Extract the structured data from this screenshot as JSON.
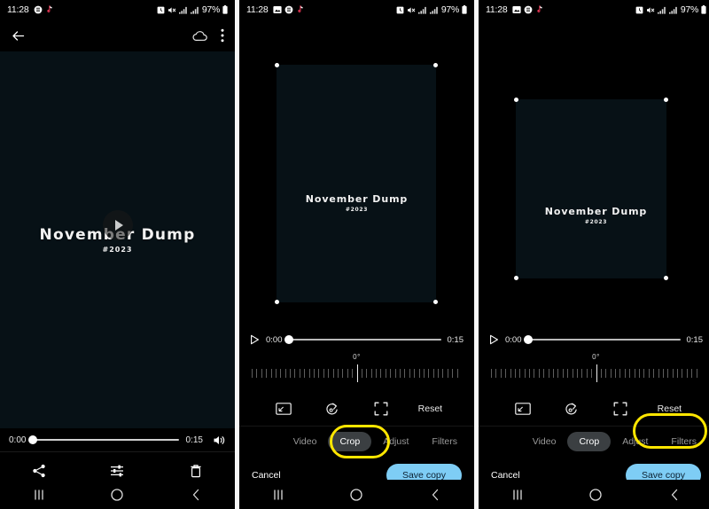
{
  "meta": {
    "app": "Samsung Gallery video editor",
    "panel_count": 3
  },
  "status_bar": {
    "time": "11:28",
    "battery": "97%",
    "left_icons_p1": [
      "browser-icon",
      "tiktok-icon"
    ],
    "left_icons_p2": [
      "image-icon",
      "browser-icon",
      "tiktok-icon"
    ],
    "right_icons": [
      "alarm-icon",
      "mute-icon",
      "signal-icon",
      "signal-icon",
      "battery-icon"
    ]
  },
  "panel1": {
    "appbar": {
      "back_icon": "arrow-left-icon",
      "cloud_icon": "cloud-icon",
      "more_icon": "more-vert-icon"
    },
    "video": {
      "title": "November Dump",
      "subtitle": "#2023",
      "play_icon": "play-icon"
    },
    "seek": {
      "current_time": "0:00",
      "total_time": "0:15",
      "progress_percent": 0,
      "volume_icon": "volume-icon"
    },
    "actions": [
      {
        "label": "Share",
        "icon": "share-icon"
      },
      {
        "label": "Edit",
        "icon": "sliders-icon"
      },
      {
        "label": "Delete",
        "icon": "trash-icon"
      }
    ]
  },
  "panel2": {
    "video": {
      "title": "November Dump",
      "subtitle": "#2023"
    },
    "seek": {
      "play_icon": "play-icon",
      "current_time": "0:00",
      "total_time": "0:15",
      "progress_percent": 0
    },
    "rotation": {
      "value": "0°"
    },
    "tools": [
      {
        "name": "aspect-ratio-icon"
      },
      {
        "name": "rotate-icon"
      },
      {
        "name": "free-crop-icon"
      }
    ],
    "reset_label": "Reset",
    "tabs": [
      {
        "label": "Video",
        "selected": false
      },
      {
        "label": "Crop",
        "selected": true
      },
      {
        "label": "Adjust",
        "selected": false
      },
      {
        "label": "Filters",
        "selected": false
      }
    ],
    "cancel_label": "Cancel",
    "save_label": "Save copy",
    "highlight_target": "tab-crop"
  },
  "panel3": {
    "video": {
      "title": "November Dump",
      "subtitle": "#2023"
    },
    "seek": {
      "play_icon": "play-icon",
      "current_time": "0:00",
      "total_time": "0:15",
      "progress_percent": 0
    },
    "rotation": {
      "value": "0°"
    },
    "tools": [
      {
        "name": "aspect-ratio-icon"
      },
      {
        "name": "rotate-icon"
      },
      {
        "name": "free-crop-icon"
      }
    ],
    "reset_label": "Reset",
    "tabs": [
      {
        "label": "Video",
        "selected": false
      },
      {
        "label": "Crop",
        "selected": true
      },
      {
        "label": "Adjust",
        "selected": false
      },
      {
        "label": "Filters",
        "selected": false
      }
    ],
    "cancel_label": "Cancel",
    "save_label": "Save copy",
    "highlight_target": "save-copy-button"
  },
  "navbar": {
    "recents_icon": "recents-icon",
    "home_icon": "home-icon",
    "back_icon": "back-icon"
  },
  "colors": {
    "video_bg": "#071116",
    "panel_bg": "#000000",
    "accent_save": "#7ecdf5",
    "highlight": "#ffe600",
    "tab_selected_bg": "#3b3f42"
  }
}
